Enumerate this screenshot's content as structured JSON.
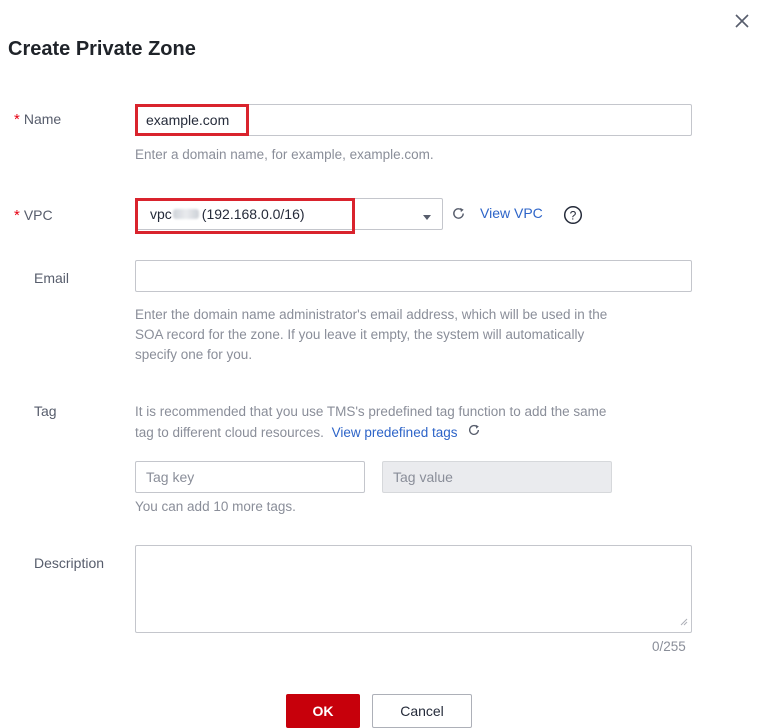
{
  "dialog": {
    "title": "Create Private Zone",
    "close_icon": "close-icon"
  },
  "fields": {
    "name": {
      "required_mark": "*",
      "label": "Name",
      "value": "example.com",
      "hint": "Enter a domain name, for example, example.com."
    },
    "vpc": {
      "required_mark": "*",
      "label": "VPC",
      "value_prefix": "vpc",
      "value_suffix": "(192.168.0.0/16)",
      "view_vpc_link": "View VPC",
      "refresh_icon": "refresh-icon",
      "help_icon": "question-circle-icon"
    },
    "email": {
      "label": "Email",
      "value": "",
      "hint_line1": "Enter the domain name administrator's email address, which will be used in the",
      "hint_line2": "SOA record for the zone. If you leave it empty, the system will automatically",
      "hint_line3": "specify one for you."
    },
    "tag": {
      "label": "Tag",
      "info_line1": "It is recommended that you use TMS's predefined tag function to add the same",
      "info_line2": "tag to different cloud resources.",
      "view_tags_link": "View predefined tags",
      "key_placeholder": "Tag key",
      "value_placeholder": "Tag value",
      "remaining": "You can add 10 more tags."
    },
    "description": {
      "label": "Description",
      "value": "",
      "counter": "0/255"
    }
  },
  "buttons": {
    "ok": "OK",
    "cancel": "Cancel"
  },
  "colors": {
    "accent_red": "#c7000b",
    "highlight_red": "#d9232d",
    "link_blue": "#2d64c8"
  }
}
